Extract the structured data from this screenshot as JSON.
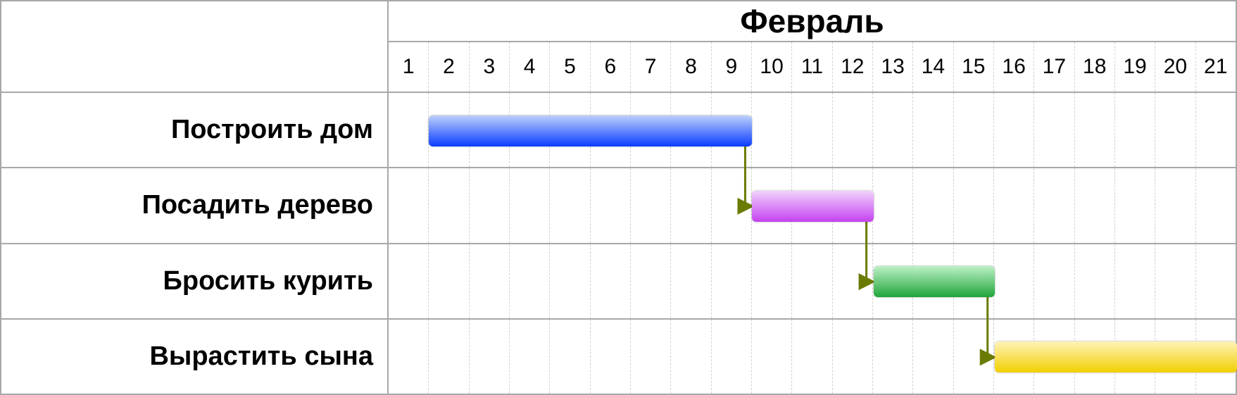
{
  "chart_data": {
    "type": "gantt",
    "title": "Февраль",
    "days": [
      1,
      2,
      3,
      4,
      5,
      6,
      7,
      8,
      9,
      10,
      11,
      12,
      13,
      14,
      15,
      16,
      17,
      18,
      19,
      20,
      21
    ],
    "day_count": 21,
    "tasks": [
      {
        "label": "Построить дом",
        "start": 2,
        "end": 9,
        "color_top": "#bcd0fb",
        "color_bottom": "#0a3cff"
      },
      {
        "label": "Посадить дерево",
        "start": 10,
        "end": 12,
        "color_top": "#f2d3fc",
        "color_bottom": "#c442f0"
      },
      {
        "label": "Бросить курить",
        "start": 13,
        "end": 15,
        "color_top": "#bdf0c6",
        "color_bottom": "#1fa63a"
      },
      {
        "label": "Вырастить сына",
        "start": 16,
        "end": 21,
        "color_top": "#fff3b8",
        "color_bottom": "#f2cf00"
      }
    ],
    "dependencies": [
      {
        "from": 0,
        "to": 1
      },
      {
        "from": 1,
        "to": 2
      },
      {
        "from": 2,
        "to": 3
      }
    ],
    "dep_color": "#6b7a00"
  }
}
